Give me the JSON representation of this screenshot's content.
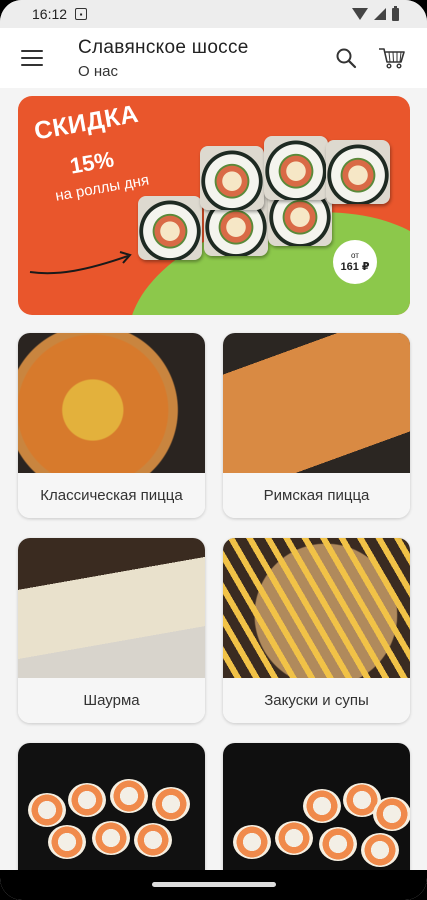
{
  "status_bar": {
    "time": "16:12",
    "notification_icon": "notification-square-icon",
    "icons": [
      "wifi-icon",
      "signal-icon",
      "battery-icon"
    ]
  },
  "app_bar": {
    "title": "Славянское шоссе",
    "subtitle": "О нас",
    "menu_icon": "hamburger-menu-icon",
    "search_icon": "search-icon",
    "cart_icon": "cart-icon"
  },
  "banner": {
    "heading": "СКИДКА",
    "percent": "15%",
    "subheading": "на роллы дня",
    "price_prefix": "от",
    "price": "161 ₽",
    "colors": {
      "background": "#e9562c",
      "accent": "#8cc84b"
    }
  },
  "categories": [
    {
      "label": "Классическая пицца"
    },
    {
      "label": "Римская пицца"
    },
    {
      "label": "Шаурма"
    },
    {
      "label": "Закуски и супы"
    },
    {
      "label": ""
    },
    {
      "label": ""
    }
  ]
}
